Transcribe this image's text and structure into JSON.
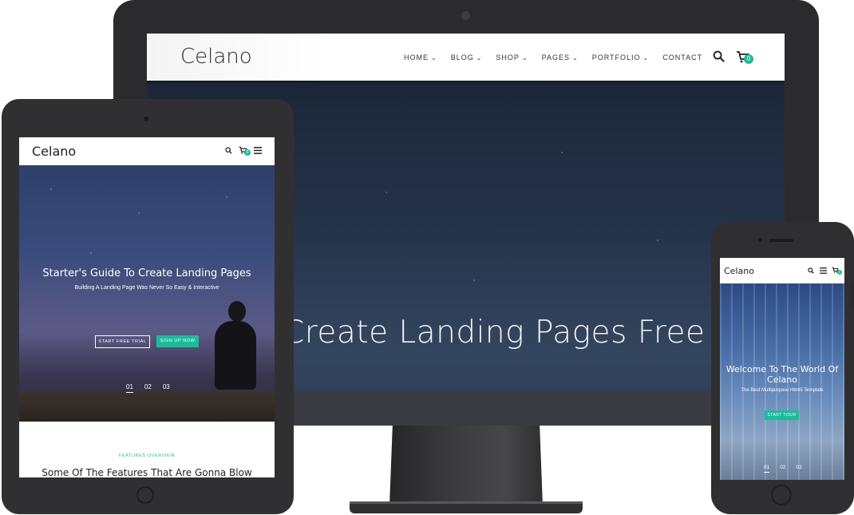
{
  "monitor": {
    "logo": "Celano",
    "menu": [
      {
        "label": "HOME",
        "has_dropdown": true
      },
      {
        "label": "BLOG",
        "has_dropdown": true
      },
      {
        "label": "SHOP",
        "has_dropdown": true
      },
      {
        "label": "PAGES",
        "has_dropdown": true
      },
      {
        "label": "PORTFOLIO",
        "has_dropdown": true
      },
      {
        "label": "CONTACT",
        "has_dropdown": false
      }
    ],
    "cart_count": "0",
    "hero_title": "Create Landing Pages Free"
  },
  "tablet": {
    "logo": "Celano",
    "cart_count": "0",
    "hero_title": "Starter's Guide To Create Landing Pages",
    "hero_subtitle": "Building A Landing Page Was Never So Easy & Interactive",
    "btn_trial": "START FREE TRIAL",
    "btn_signup": "SIGN UP NOW",
    "slides": [
      "01",
      "02",
      "03"
    ],
    "features_label": "FEATURES OVERVIEW",
    "features_title": "Some Of The Features That Are Gonna Blow"
  },
  "phone": {
    "logo": "Celano",
    "cart_count": "0",
    "hero_title": "Welcome To The World Of Celano",
    "hero_subtitle": "The Best Multipurpose Html5 Template",
    "btn_tour": "START TOUR",
    "slides": [
      "01",
      "02",
      "03"
    ]
  },
  "colors": {
    "accent": "#1bbc9b",
    "device_frame": "#2b2b2d"
  }
}
